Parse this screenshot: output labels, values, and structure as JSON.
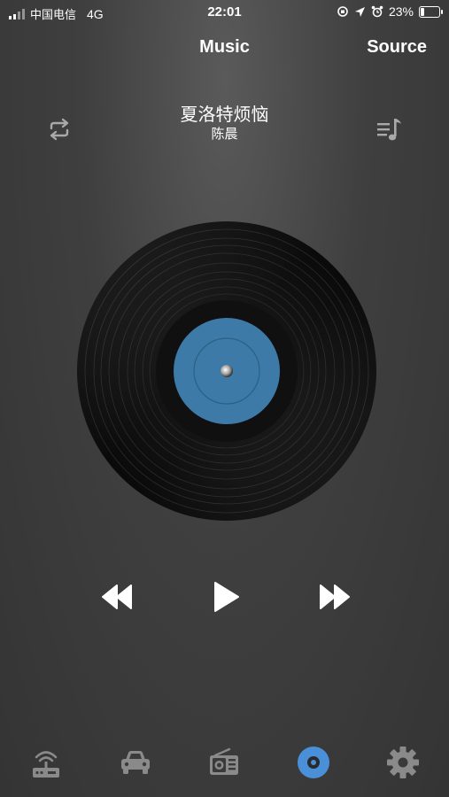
{
  "status_bar": {
    "carrier": "中国电信",
    "network": "4G",
    "time": "22:01",
    "battery_percent_label": "23%",
    "battery_level": 0.23
  },
  "header": {
    "title": "Music",
    "source_label": "Source"
  },
  "song": {
    "title": "夏洛特烦恼",
    "artist": "陈晨"
  },
  "icons": {
    "repeat": "repeat-icon",
    "playlist": "playlist-icon",
    "rewind": "rewind-icon",
    "play": "play-icon",
    "fast_forward": "fast-forward-icon"
  },
  "tabs": [
    {
      "name": "router",
      "icon": "router-icon",
      "active": false
    },
    {
      "name": "car",
      "icon": "car-icon",
      "active": false
    },
    {
      "name": "radio",
      "icon": "radio-icon",
      "active": false
    },
    {
      "name": "music",
      "icon": "disc-icon",
      "active": true
    },
    {
      "name": "settings",
      "icon": "gear-icon",
      "active": false
    }
  ],
  "colors": {
    "accent": "#4a90d9",
    "vinyl_label": "#3d7aa8",
    "inactive_tab": "#8a8a8a"
  }
}
